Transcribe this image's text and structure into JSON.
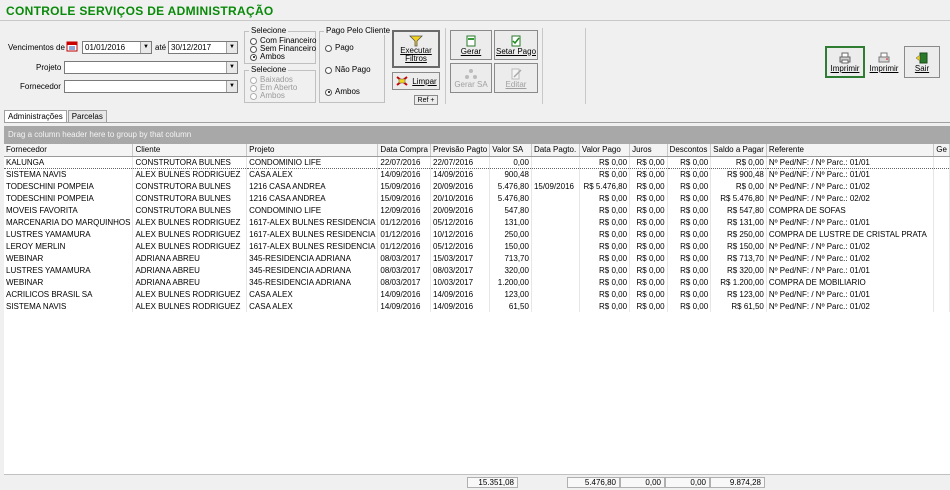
{
  "app": {
    "title": "CONTROLE SERVIÇOS DE ADMINISTRAÇÃO"
  },
  "filters": {
    "vencimentos_label": "Vencimentos de",
    "date_from": "01/01/2016",
    "ate_label": "até",
    "date_to": "30/12/2017",
    "projeto_label": "Projeto",
    "projeto_value": "",
    "fornecedor_label": "Fornecedor",
    "fornecedor_value": ""
  },
  "selecione1": {
    "title": "Selecione",
    "options": [
      "Com Financeiro",
      "Sem Financeiro",
      "Ambos"
    ],
    "selected": 2
  },
  "selecione2": {
    "title": "Selecione",
    "options": [
      "Baixados",
      "Em Aberto",
      "Ambos"
    ]
  },
  "pago_cliente": {
    "title": "Pago Pelo Cliente",
    "options": [
      "Pago",
      "Não Pago",
      "Ambos"
    ],
    "selected": 2
  },
  "buttons": {
    "executar": "Executar Filtros",
    "limpar": "Limpar",
    "ref": "Ref +",
    "gerar": "Gerar",
    "setar_pago": "Setar Pago",
    "gerar_sa": "Gerar SA",
    "editar": "Editar",
    "imprimir1": "Imprimir",
    "imprimir2": "Imprimir",
    "sair": "Sair"
  },
  "tabs": [
    "Administrações",
    "Parcelas"
  ],
  "grid": {
    "group_hint": "Drag a column header here to group by that column",
    "columns": [
      "Fornecedor",
      "Cliente",
      "Projeto",
      "Data Compra",
      "Previsão Pagto",
      "Valor SA",
      "Data Pagto.",
      "Valor Pago",
      "Juros",
      "Descontos",
      "Saldo a Pagar",
      "Referente",
      "Ge"
    ],
    "rows": [
      [
        "KALUNGA",
        "CONSTRUTORA BULNES",
        "CONDOMINIO LIFE",
        "22/07/2016",
        "22/07/2016",
        "0,00",
        "",
        "R$ 0,00",
        "R$ 0,00",
        "R$ 0,00",
        "R$ 0,00",
        "Nº Ped/NF:  / Nº Parc.: 01/01",
        ""
      ],
      [
        "SISTEMA NAVIS",
        "ALEX BULNES RODRIGUEZ",
        "CASA ALEX",
        "14/09/2016",
        "14/09/2016",
        "900,48",
        "",
        "R$ 0,00",
        "R$ 0,00",
        "R$ 0,00",
        "R$ 900,48",
        "Nº Ped/NF:  / Nº Parc.: 01/01",
        ""
      ],
      [
        "TODESCHINI POMPEIA",
        "CONSTRUTORA BULNES",
        "1216 CASA ANDREA",
        "15/09/2016",
        "20/09/2016",
        "5.476,80",
        "15/09/2016",
        "R$ 5.476,80",
        "R$ 0,00",
        "R$ 0,00",
        "R$ 0,00",
        "Nº Ped/NF:  / Nº Parc.: 01/02",
        ""
      ],
      [
        "TODESCHINI POMPEIA",
        "CONSTRUTORA BULNES",
        "1216 CASA ANDREA",
        "15/09/2016",
        "20/10/2016",
        "5.476,80",
        "",
        "R$ 0,00",
        "R$ 0,00",
        "R$ 0,00",
        "R$ 5.476,80",
        "Nº Ped/NF:  / Nº Parc.: 02/02",
        ""
      ],
      [
        "MOVEIS FAVORITA",
        "CONSTRUTORA BULNES",
        "CONDOMINIO LIFE",
        "12/09/2016",
        "20/09/2016",
        "547,80",
        "",
        "R$ 0,00",
        "R$ 0,00",
        "R$ 0,00",
        "R$ 547,80",
        "COMPRA DE SOFAS",
        ""
      ],
      [
        "MARCENARIA DO MARQUINHOS",
        "ALEX BULNES RODRIGUEZ",
        "1617-ALEX BULNES RESIDENCIA",
        "01/12/2016",
        "05/12/2016",
        "131,00",
        "",
        "R$ 0,00",
        "R$ 0,00",
        "R$ 0,00",
        "R$ 131,00",
        "Nº Ped/NF:  / Nº Parc.: 01/01",
        ""
      ],
      [
        "LUSTRES YAMAMURA",
        "ALEX BULNES RODRIGUEZ",
        "1617-ALEX BULNES RESIDENCIA",
        "01/12/2016",
        "10/12/2016",
        "250,00",
        "",
        "R$ 0,00",
        "R$ 0,00",
        "R$ 0,00",
        "R$ 250,00",
        "COMPRA DE LUSTRE DE CRISTAL PRATA",
        ""
      ],
      [
        "LEROY MERLIN",
        "ALEX BULNES RODRIGUEZ",
        "1617-ALEX BULNES RESIDENCIA",
        "01/12/2016",
        "05/12/2016",
        "150,00",
        "",
        "R$ 0,00",
        "R$ 0,00",
        "R$ 0,00",
        "R$ 150,00",
        "Nº Ped/NF:  / Nº Parc.: 01/02",
        ""
      ],
      [
        "WEBINAR",
        "ADRIANA ABREU",
        "345-RESIDENCIA ADRIANA",
        "08/03/2017",
        "15/03/2017",
        "713,70",
        "",
        "R$ 0,00",
        "R$ 0,00",
        "R$ 0,00",
        "R$ 713,70",
        "Nº Ped/NF:  / Nº Parc.: 01/02",
        ""
      ],
      [
        "LUSTRES YAMAMURA",
        "ADRIANA ABREU",
        "345-RESIDENCIA ADRIANA",
        "08/03/2017",
        "08/03/2017",
        "320,00",
        "",
        "R$ 0,00",
        "R$ 0,00",
        "R$ 0,00",
        "R$ 320,00",
        "Nº Ped/NF:  / Nº Parc.: 01/01",
        ""
      ],
      [
        "WEBINAR",
        "ADRIANA ABREU",
        "345-RESIDENCIA ADRIANA",
        "08/03/2017",
        "10/03/2017",
        "1.200,00",
        "",
        "R$ 0,00",
        "R$ 0,00",
        "R$ 0,00",
        "R$ 1.200,00",
        "COMPRA DE MOBILIARIO",
        ""
      ],
      [
        "ACRILICOS BRASIL SA",
        "ALEX BULNES RODRIGUEZ",
        "CASA ALEX",
        "14/09/2016",
        "14/09/2016",
        "123,00",
        "",
        "R$ 0,00",
        "R$ 0,00",
        "R$ 0,00",
        "R$ 123,00",
        "Nº Ped/NF:  / Nº Parc.: 01/01",
        ""
      ],
      [
        "SISTEMA NAVIS",
        "ALEX BULNES RODRIGUEZ",
        "CASA ALEX",
        "14/09/2016",
        "14/09/2016",
        "61,50",
        "",
        "R$ 0,00",
        "R$ 0,00",
        "R$ 0,00",
        "R$ 61,50",
        "Nº Ped/NF:  / Nº Parc.: 01/02",
        ""
      ]
    ]
  },
  "totals": {
    "valor_sa": "15.351,08",
    "valor_pago": "5.476,80",
    "juros": "0,00",
    "descontos": "0,00",
    "saldo": "9.874,28"
  },
  "icons": {
    "filter": "funnel-icon",
    "clear": "eraser-icon",
    "print": "printer-icon",
    "exit": "exit-door-icon",
    "calendar": "calendar-icon"
  },
  "colors": {
    "title": "#0a8a0a",
    "group_band": "#a8a8a8",
    "selected_border": "#2e7d32"
  }
}
